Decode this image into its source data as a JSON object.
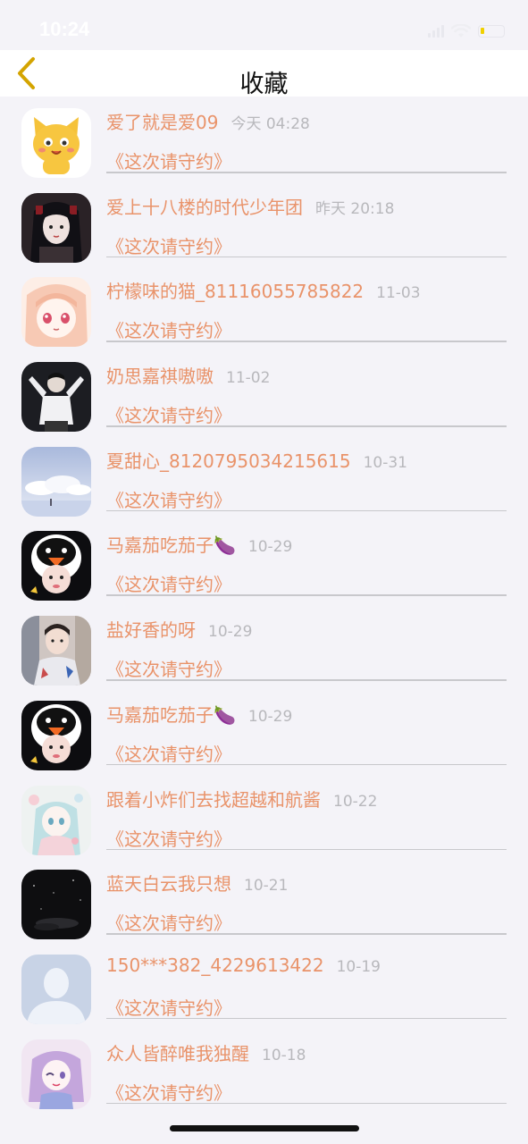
{
  "status_bar": {
    "time": "10:24",
    "battery_color": "#f0d000"
  },
  "nav": {
    "title": "收藏",
    "back_icon": "chevron-left-icon",
    "back_color": "#d4a400"
  },
  "accent_color": "#e9936a",
  "items": [
    {
      "name": "爱了就是爱09",
      "time": "今天 04:28",
      "message": "《这次请守约》",
      "avatar": "yellow-cat-avatar"
    },
    {
      "name": "爱上十八楼的时代少年团",
      "time": "昨天 20:18",
      "message": "《这次请守约》",
      "avatar": "dark-hair-girl-avatar"
    },
    {
      "name": "柠檬味的猫_81116055785822",
      "time": "11-03",
      "message": "《这次请守约》",
      "avatar": "anime-pink-girl-avatar"
    },
    {
      "name": "奶思嘉祺嗷嗷",
      "time": "11-02",
      "message": "《这次请守约》",
      "avatar": "dancer-avatar"
    },
    {
      "name": "夏甜心_8120795034215615",
      "time": "10-31",
      "message": "《这次请守约》",
      "avatar": "sky-clouds-avatar"
    },
    {
      "name": "马嘉茄吃茄子🍆",
      "time": "10-29",
      "message": "《这次请守约》",
      "avatar": "penguin-hat-avatar"
    },
    {
      "name": "盐好香的呀",
      "time": "10-29",
      "message": "《这次请守约》",
      "avatar": "boy-photo-avatar"
    },
    {
      "name": "马嘉茄吃茄子🍆",
      "time": "10-29",
      "message": "《这次请守约》",
      "avatar": "penguin-hat-avatar"
    },
    {
      "name": "跟着小炸们去找超越和航酱",
      "time": "10-22",
      "message": "《这次请守约》",
      "avatar": "pastel-anime-avatar"
    },
    {
      "name": "蓝天白云我只想",
      "time": "10-21",
      "message": "《这次请守约》",
      "avatar": "night-sky-avatar"
    },
    {
      "name": "150***382_4229613422",
      "time": "10-19",
      "message": "《这次请守约》",
      "avatar": "default-person-avatar"
    },
    {
      "name": "众人皆醉唯我独醒",
      "time": "10-18",
      "message": "《这次请守约》",
      "avatar": "purple-anime-avatar"
    }
  ]
}
